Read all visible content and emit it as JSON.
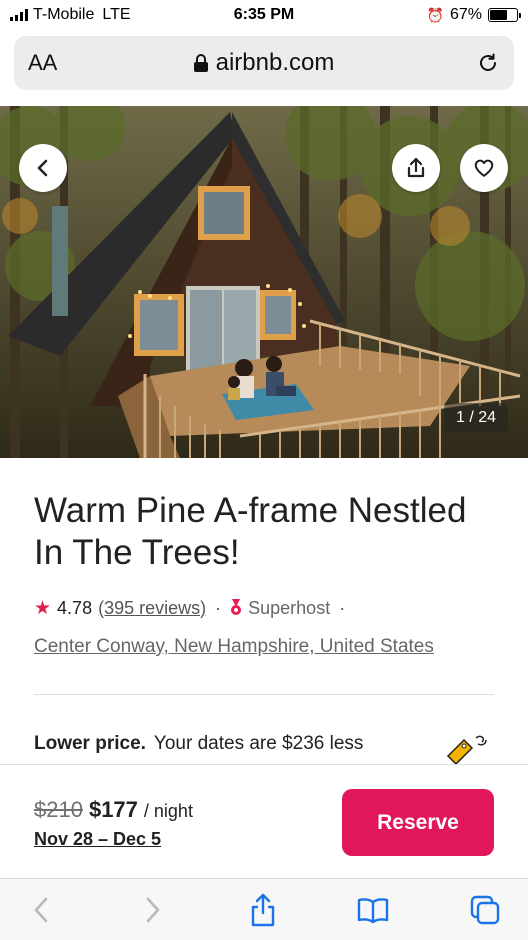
{
  "status_bar": {
    "carrier": "T-Mobile",
    "network": "LTE",
    "time": "6:35 PM",
    "battery": "67%",
    "battery_level": 0.67
  },
  "address_bar": {
    "text_size_label": "AA",
    "url": "airbnb.com"
  },
  "hero": {
    "photo_counter": "1 / 24"
  },
  "listing": {
    "title": "Warm Pine A-frame Nestled In The Trees!",
    "rating": "4.78",
    "reviews": "(395 reviews)",
    "separator": "·",
    "superhost": "Superhost",
    "location": "Center Conway, New Hampshire, United States"
  },
  "promo": {
    "headline": "Lower price.",
    "text": "Your dates are $236 less"
  },
  "footer": {
    "old_price": "$210",
    "price": "$177",
    "per_night": "/ night",
    "dates": "Nov 28 – Dec 5",
    "reserve_label": "Reserve"
  },
  "colors": {
    "brand": "#e1175d",
    "star": "#e61e4d",
    "safari_blue": "#1a73e8"
  }
}
